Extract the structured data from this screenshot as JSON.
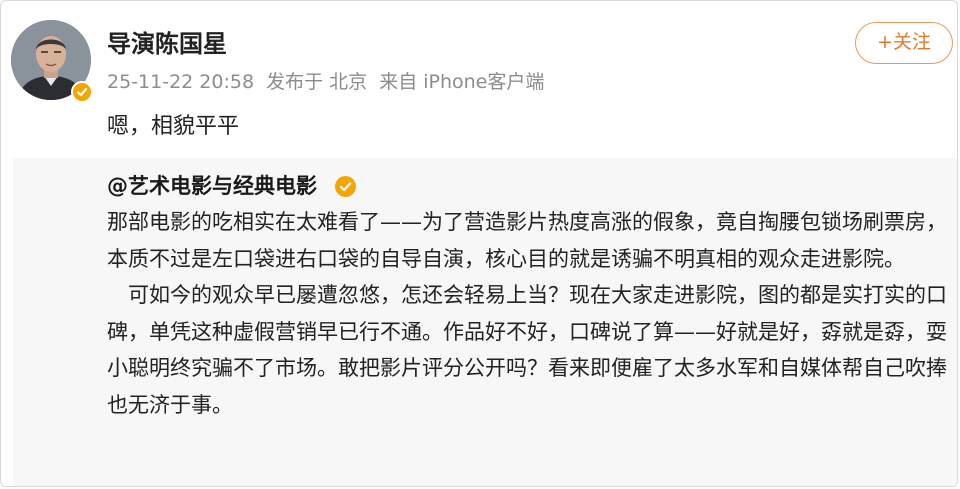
{
  "post": {
    "author": "导演陈国星",
    "meta": {
      "datetime": "25-11-22 20:58",
      "location": "发布于 北京",
      "source": "来自 iPhone客户端"
    },
    "follow_label": "+关注",
    "text": "嗯，相貌平平"
  },
  "repost": {
    "author": "@艺术电影与经典电影",
    "paragraphs": [
      "那部电影的吃相实在太难看了——为了营造影片热度高涨的假象，竟自掏腰包锁场刷票房，本质不过是左口袋进右口袋的自导自演，核心目的就是诱骗不明真相的观众走进影院。",
      "可如今的观众早已屡遭忽悠，怎还会轻易上当？现在大家走进影院，图的都是实打实的口碑，单凭这种虚假营销早已行不通。作品好不好，口碑说了算——好就是好，孬就是孬，耍小聪明终究骗不了市场。敢把影片评分公开吗？看来即便雇了太多水军和自媒体帮自己吹捧也无济于事。"
    ]
  },
  "colors": {
    "verified_badge": "#f3a600",
    "follow_accent": "#e07a2f",
    "repost_background": "#f7f7f7",
    "meta_text": "#8c8c8c"
  },
  "icons": {
    "avatar": "user-portrait",
    "verified": "verified-badge-icon"
  }
}
